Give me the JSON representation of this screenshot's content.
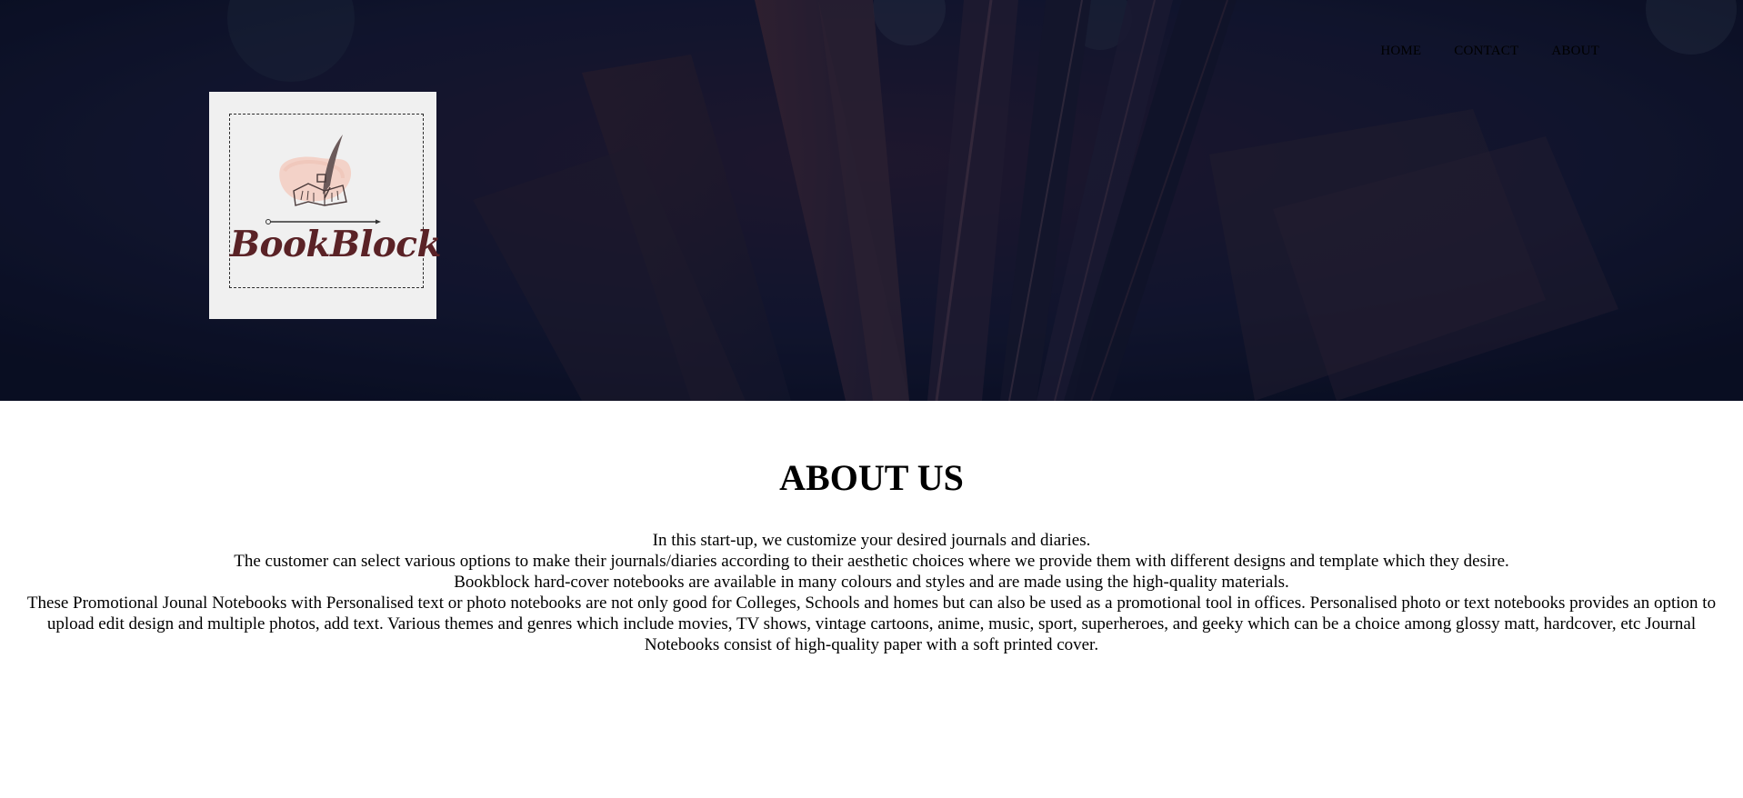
{
  "nav": {
    "items": [
      {
        "label": "HOME"
      },
      {
        "label": "CONTACT"
      },
      {
        "label": "ABOUT"
      }
    ]
  },
  "logo": {
    "brand_text": "BookBlock"
  },
  "about": {
    "title": "ABOUT US",
    "paragraphs": [
      "In this start-up, we customize your desired journals and diaries.",
      "The customer can select various options to make their journals/diaries according to their aesthetic choices where we provide them with different designs and template which they desire.",
      "Bookblock hard-cover notebooks are available in many colours and styles and are made using the high-quality materials.",
      "These Promotional Jounal Notebooks with Personalised text or photo notebooks are not only good for Colleges, Schools and homes but can also be used as a promotional tool in offices. Personalised photo or text notebooks provides an option to upload edit design and multiple photos, add text. Various themes and genres which include movies, TV shows, vintage cartoons, anime, music, sport, superheroes, and geeky which can be a choice among glossy matt, hardcover, etc Journal Notebooks consist of high-quality paper with a soft printed cover."
    ]
  },
  "colors": {
    "hero_background": "#0d1127",
    "brand_text": "#5a2226",
    "logo_card": "#f0f0f0"
  }
}
